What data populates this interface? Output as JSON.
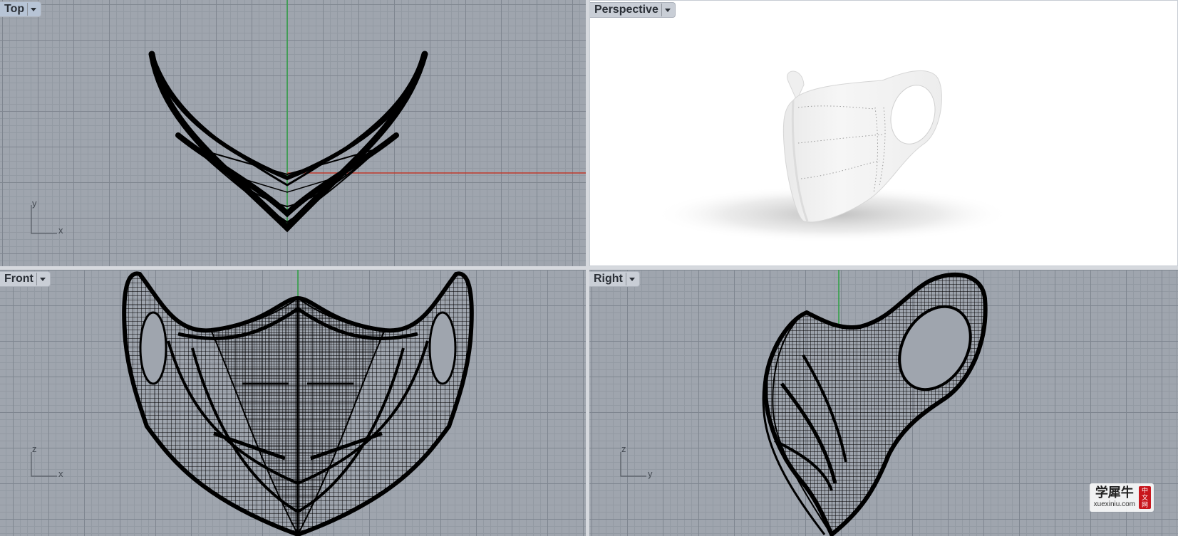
{
  "viewports": {
    "top": {
      "label": "Top",
      "axes": {
        "v": "y",
        "h": "x"
      }
    },
    "perspective": {
      "label": "Perspective"
    },
    "front": {
      "label": "Front",
      "axes": {
        "v": "z",
        "h": "x"
      }
    },
    "right": {
      "label": "Right",
      "axes": {
        "v": "z",
        "h": "y"
      }
    }
  },
  "active_viewport": "Top",
  "watermark": {
    "chinese": "学犀牛",
    "site": "xuexiniu.com",
    "seal": [
      "中",
      "文",
      "网"
    ]
  },
  "colors": {
    "grid_background": "#9fa5ae",
    "grid_major": "#7f8690",
    "grid_minor": "#939aa3",
    "x_axis": "#c0392b",
    "y_axis": "#2ea043",
    "wireframe": "#000000",
    "render_background": "#ffffff"
  },
  "icons": {
    "viewport_menu": "chevron-down-icon",
    "axis_gizmo": "axis-icon"
  }
}
